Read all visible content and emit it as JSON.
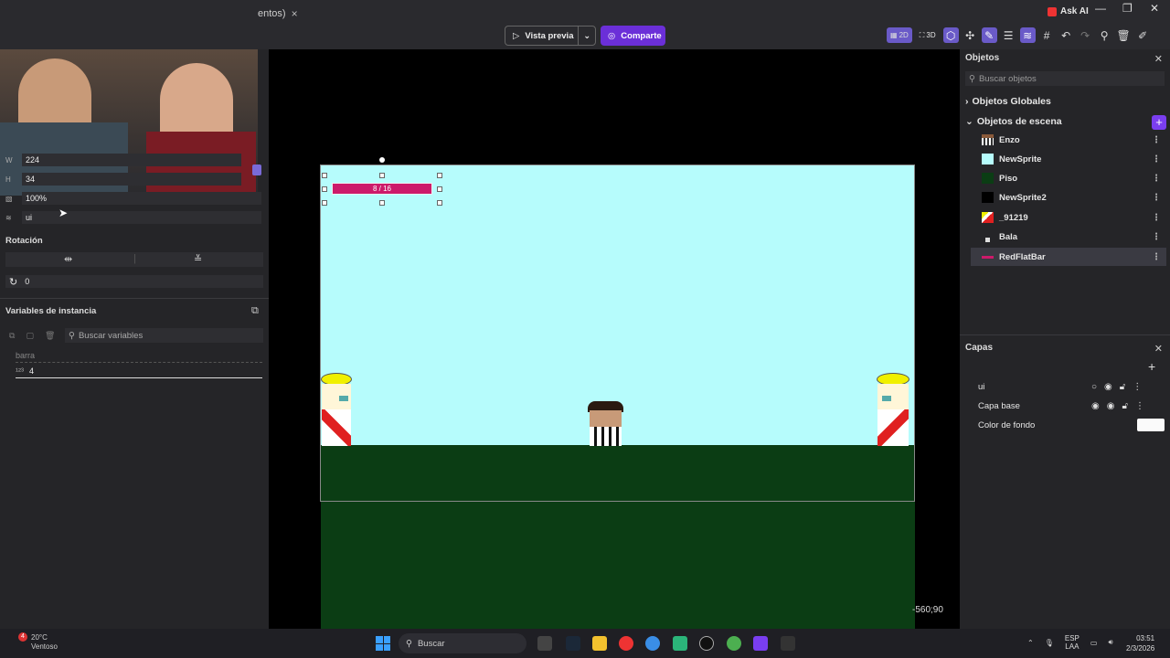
{
  "window": {
    "tab_label": "entos)",
    "tab_close": "×",
    "ask_ai": "Ask AI",
    "controls": [
      "—",
      "❐",
      "✕"
    ]
  },
  "toolbar": {
    "preview_label": "Vista previa",
    "share_label": "Comparte",
    "view_2d": "2D",
    "view_3d": "3D"
  },
  "properties": {
    "w_label": "W",
    "w_value": "224",
    "h_label": "H",
    "h_value": "34",
    "opacity_value": "100%",
    "layer_value": "ui",
    "rotation_header": "Rotación",
    "rotation_value": "0",
    "instance_vars_header": "Variables de instancia",
    "search_vars_placeholder": "Buscar variables",
    "var_name": "barra",
    "var_value": "4"
  },
  "scene": {
    "healthbar_text": "8 / 16",
    "coords": "-560;90"
  },
  "objects_panel": {
    "title": "Objetos",
    "search_placeholder": "Buscar objetos",
    "global_header": "Objetos Globales",
    "scene_header": "Objetos de escena",
    "items": [
      {
        "name": "Enzo",
        "color": "#8a5a3a"
      },
      {
        "name": "NewSprite",
        "color": "#b6fcfc"
      },
      {
        "name": "Piso",
        "color": "#0b3d14"
      },
      {
        "name": "NewSprite2",
        "color": "#000000"
      },
      {
        "name": "_91219",
        "color": "#e23a3a"
      },
      {
        "name": "Bala",
        "color": "#dddddd"
      },
      {
        "name": "RedFlatBar",
        "color": "#cc1a6a"
      }
    ]
  },
  "layers_panel": {
    "title": "Capas",
    "layers": [
      {
        "name": "ui"
      },
      {
        "name": "Capa base"
      }
    ],
    "bg_label": "Color de fondo"
  },
  "taskbar": {
    "temp": "20°C",
    "weather": "Ventoso",
    "badge": "4",
    "search": "Buscar",
    "lang1": "ESP",
    "lang2": "LAA",
    "time": "03:51",
    "date": "2/3/2026"
  }
}
